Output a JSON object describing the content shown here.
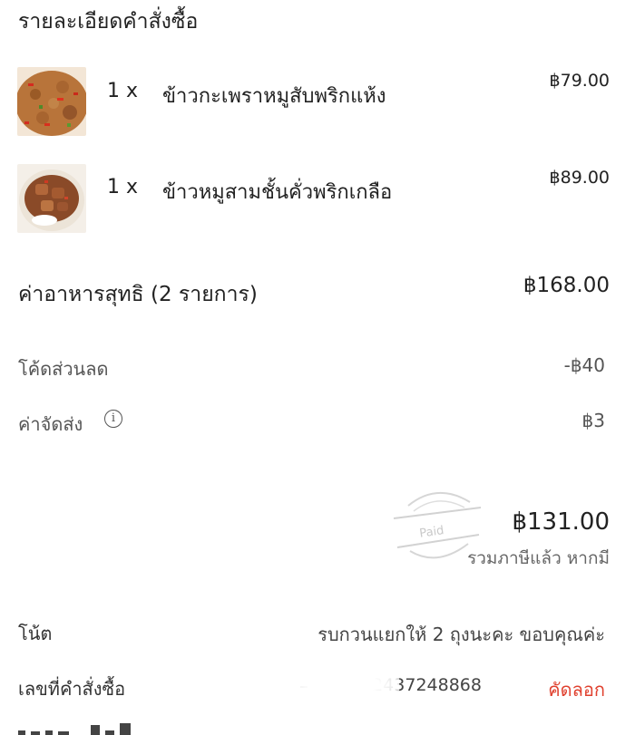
{
  "header": {
    "title": "รายละเอียดคำสั่งซื้อ"
  },
  "items": [
    {
      "qty": "1 x",
      "name": "ข้าวกะเพราหมูสับพริกแห้ง",
      "price": "฿79.00"
    },
    {
      "qty": "1 x",
      "name": "ข้าวหมูสามชั้นคั่วพริกเกลือ",
      "price": "฿89.00"
    }
  ],
  "subtotal": {
    "label": "ค่าอาหารสุทธิ (2 รายการ)",
    "value": "฿168.00"
  },
  "discount": {
    "label": "โค้ดส่วนลด",
    "value": "-฿40"
  },
  "delivery": {
    "label": "ค่าจัดส่ง",
    "value": "฿3",
    "info_icon": "i"
  },
  "total": {
    "value": "฿131.00",
    "note": "รวมภาษีแล้ว หากมี"
  },
  "stamp": {
    "text": "Paid"
  },
  "note": {
    "label": "โน้ต",
    "value": "รบกวนแยกให้ 2 ถุงนะคะ ขอบคุณค่ะ"
  },
  "order": {
    "label": "เลขที่คำสั่งซื้อ",
    "number_visible": "72437248868",
    "copy_label": "คัดลอก"
  }
}
